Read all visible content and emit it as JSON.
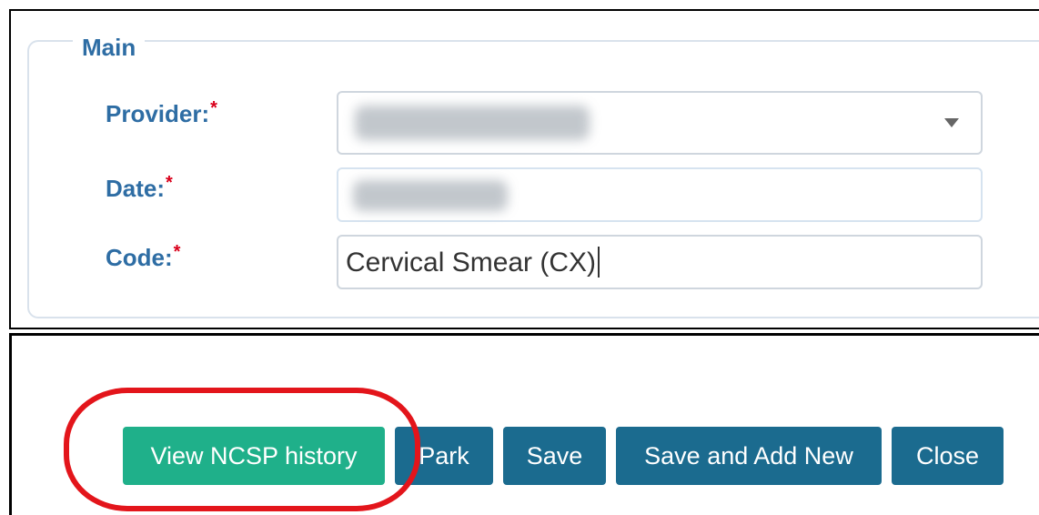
{
  "fieldset": {
    "legend": "Main"
  },
  "fields": {
    "provider": {
      "label": "Provider:",
      "required_mark": "*"
    },
    "date": {
      "label": "Date:",
      "required_mark": "*"
    },
    "code": {
      "label": "Code:",
      "required_mark": "*",
      "value": "Cervical Smear (CX)"
    }
  },
  "buttons": {
    "view_ncsp_history": "View NCSP history",
    "park": "Park",
    "save": "Save",
    "save_and_add_new": "Save and Add New",
    "close": "Close"
  },
  "colors": {
    "label": "#2e6da4",
    "required": "#d9001b",
    "teal_button": "#1fb08a",
    "blue_button": "#1b6b8f",
    "highlight": "#e3151b"
  },
  "icons": {
    "provider_dropdown": "chevron-down-icon"
  }
}
